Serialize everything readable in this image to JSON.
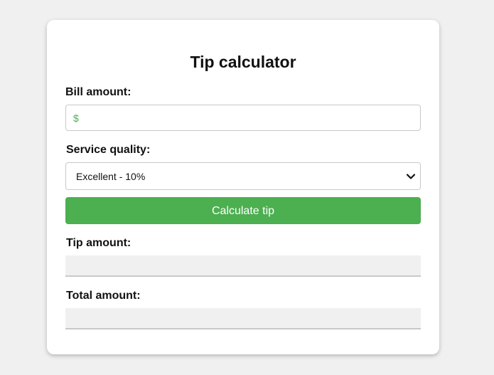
{
  "app": {
    "title": "Tip calculator"
  },
  "form": {
    "bill_label": "Bill amount:",
    "bill_placeholder": "$",
    "bill_value": "",
    "service_label": "Service quality:",
    "service_selected": "Excellent - 10%",
    "calculate_label": "Calculate tip",
    "tip_label": "Tip amount:",
    "tip_value": "",
    "total_label": "Total amount:",
    "total_value": ""
  },
  "colors": {
    "accent": "#4caf50",
    "page_background": "#f0f0f0",
    "card_background": "#ffffff"
  },
  "icons": {
    "select_arrow": "chevron-down-icon"
  }
}
